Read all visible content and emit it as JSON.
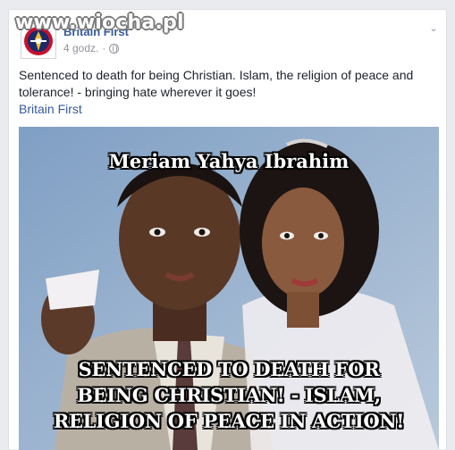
{
  "watermark": "www.wiocha.pl",
  "post": {
    "page_name": "Britain First",
    "timestamp": "4 godz.",
    "separator": "·",
    "text": "Sentenced to death for being Christian. Islam, the religion of peace and tolerance! - bringing hate wherever it goes!",
    "link_text": "Britain First",
    "menu_icon": "chevron-down-icon",
    "privacy_icon": "globe-icon"
  },
  "image": {
    "caption_top": "Meriam Yahya Ibrahim",
    "caption_bottom": [
      "SENTENCED TO DEATH FOR",
      "BEING CHRISTIAN! - ISLAM,",
      "RELIGION OF PEACE IN ACTION!"
    ]
  },
  "colors": {
    "link": "#365899",
    "text": "#1d2129",
    "meta": "#90949c",
    "background": "#e9ebee"
  }
}
